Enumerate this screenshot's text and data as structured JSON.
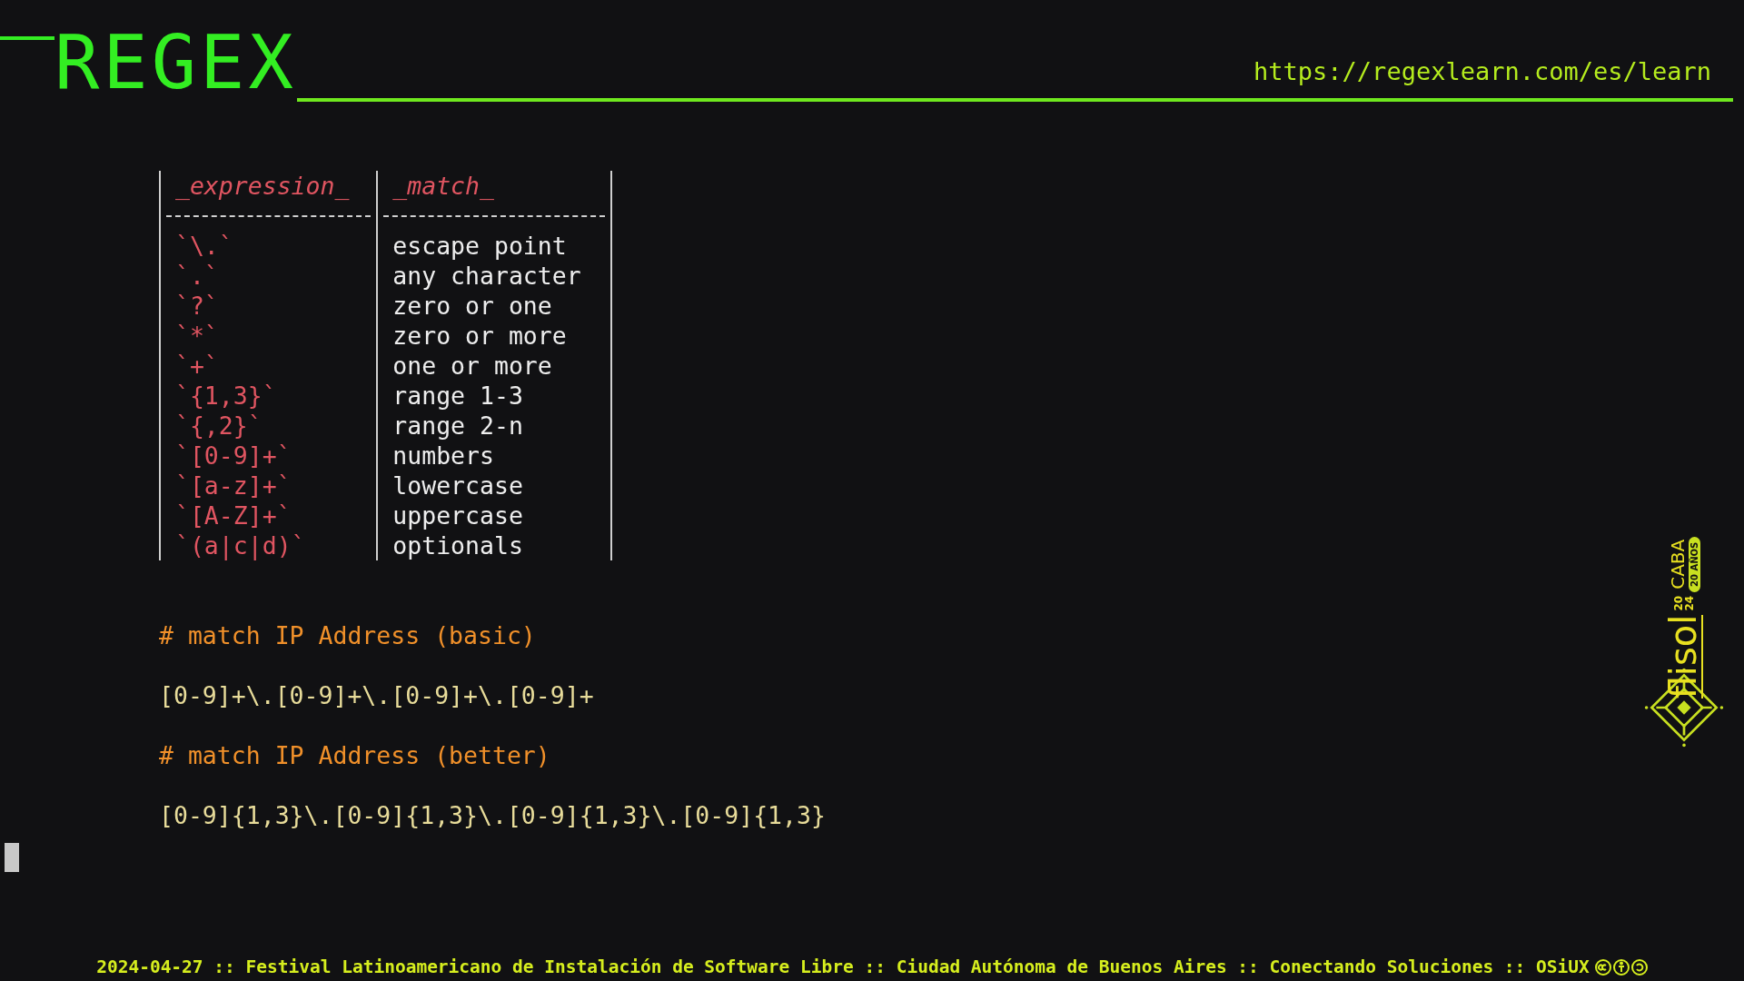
{
  "header": {
    "logo": "REGEX",
    "url": "https://regexlearn.com/es/learn"
  },
  "table": {
    "columns": [
      "_expression_",
      "_match_"
    ],
    "rows": [
      {
        "expression": "`\\.`",
        "match": "escape point"
      },
      {
        "expression": "`.`",
        "match": "any character"
      },
      {
        "expression": "`?`",
        "match": "zero or one"
      },
      {
        "expression": "`*`",
        "match": "zero or more"
      },
      {
        "expression": "`+`",
        "match": "one or more"
      },
      {
        "expression": "`{1,3}`",
        "match": "range 1-3"
      },
      {
        "expression": "`{,2}`",
        "match": "range 2-n"
      },
      {
        "expression": "`[0-9]+`",
        "match": "numbers"
      },
      {
        "expression": "`[a-z]+`",
        "match": "lowercase"
      },
      {
        "expression": "`[A-Z]+`",
        "match": "uppercase"
      },
      {
        "expression": "`(a|c|d)`",
        "match": "optionals"
      }
    ]
  },
  "sections": [
    {
      "kind": "comment",
      "text": "# match IP Address (basic)"
    },
    {
      "kind": "code",
      "text": "[0-9]+\\.[0-9]+\\.[0-9]+\\.[0-9]+"
    },
    {
      "kind": "comment",
      "text": "# match IP Address (better)"
    },
    {
      "kind": "code",
      "text": "[0-9]{1,3}\\.[0-9]{1,3}\\.[0-9]{1,3}\\.[0-9]{1,3}"
    }
  ],
  "badge": {
    "name": "flisol",
    "year": [
      "20",
      "24"
    ],
    "city": "CABA",
    "tag": "20 AÑOS"
  },
  "footer": {
    "text": "2024-04-27 :: Festival Latinoamericano de Instalación de Software Libre :: Ciudad Autónoma de Buenos Aires :: Conectando Soluciones :: OSiUX"
  }
}
